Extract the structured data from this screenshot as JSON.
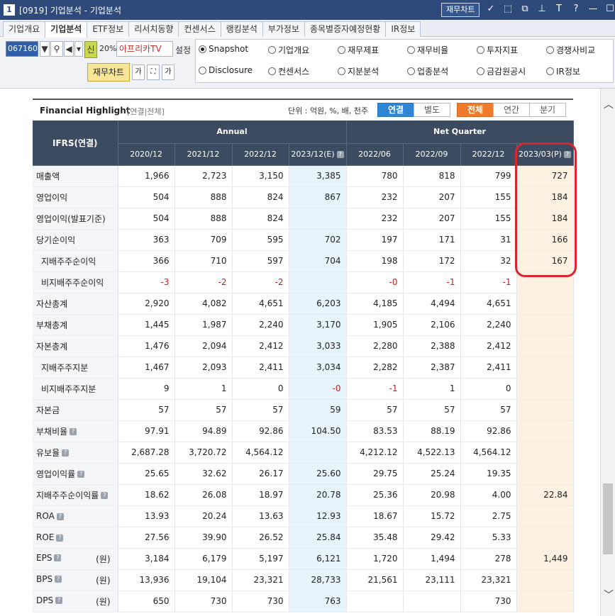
{
  "window": {
    "number": "1",
    "title": "[0919] 기업분석 - 기업분석",
    "chart_button": "재무차트",
    "icons": [
      "link-icon",
      "restore-icon",
      "copy-icon",
      "pin-icon",
      "font-icon",
      "help-icon",
      "minimize-icon",
      "maximize-icon",
      "close-icon"
    ],
    "icon_glyphs": [
      "✓",
      "⬚",
      "⧉",
      "⊥",
      "T",
      "?",
      "—",
      "☐",
      "✕"
    ]
  },
  "tabs": [
    "기업개요",
    "기업분석",
    "ETF정보",
    "리서치동향",
    "컨센서스",
    "랭킹분석",
    "부가정보",
    "종목별증자예정현황",
    "IR정보"
  ],
  "active_tab": "기업분석",
  "toolbar": {
    "stock_code": "067160",
    "shin_label": "신",
    "percent": "20%",
    "stock_name": "아프리카TV",
    "setting_label": "설정",
    "fin_chart_button": "재무차트"
  },
  "radios": [
    {
      "label": "Snapshot",
      "checked": true
    },
    {
      "label": "기업개요",
      "checked": false
    },
    {
      "label": "재무제표",
      "checked": false
    },
    {
      "label": "재무비율",
      "checked": false
    },
    {
      "label": "투자지표",
      "checked": false
    },
    {
      "label": "경쟁사비교",
      "checked": false
    },
    {
      "label": "Disclosure",
      "checked": false
    },
    {
      "label": "컨센서스",
      "checked": false
    },
    {
      "label": "지분분석",
      "checked": false
    },
    {
      "label": "업종분석",
      "checked": false
    },
    {
      "label": "금감원공시",
      "checked": false
    },
    {
      "label": "IR정보",
      "checked": false
    }
  ],
  "highlight": {
    "title": "Financial Highlight",
    "subtitle": "[연결|전체]",
    "unit": "단위 : 억원, %, 배, 천주",
    "consolidation_toggle": [
      "연결",
      "별도"
    ],
    "consolidation_selected": "연결",
    "period_toggle": [
      "전체",
      "연간",
      "분기"
    ],
    "period_selected": "전체"
  },
  "table": {
    "row_header": "IFRS(연결)",
    "group_annual": "Annual",
    "group_quarter": "Net Quarter",
    "columns": [
      "2020/12",
      "2021/12",
      "2022/12",
      "2023/12(E)",
      "2022/06",
      "2022/09",
      "2022/12",
      "2023/03(P)"
    ],
    "rows": [
      {
        "label": "매출액",
        "sub": false,
        "info": false,
        "unit": "",
        "values": [
          "1,966",
          "2,723",
          "3,150",
          "3,385",
          "780",
          "818",
          "799",
          "727"
        ]
      },
      {
        "label": "영업이익",
        "sub": false,
        "info": false,
        "unit": "",
        "values": [
          "504",
          "888",
          "824",
          "867",
          "232",
          "207",
          "155",
          "184"
        ]
      },
      {
        "label": "영업이익(발표기준)",
        "sub": false,
        "info": false,
        "unit": "",
        "values": [
          "504",
          "888",
          "824",
          "",
          "232",
          "207",
          "155",
          "184"
        ]
      },
      {
        "label": "당기순이익",
        "sub": false,
        "info": false,
        "unit": "",
        "values": [
          "363",
          "709",
          "595",
          "702",
          "197",
          "171",
          "31",
          "166"
        ]
      },
      {
        "label": "지배주주순이익",
        "sub": true,
        "info": false,
        "unit": "",
        "values": [
          "366",
          "710",
          "597",
          "704",
          "198",
          "172",
          "32",
          "167"
        ]
      },
      {
        "label": "비지배주주순이익",
        "sub": true,
        "info": false,
        "unit": "",
        "values": [
          "-3",
          "-2",
          "-2",
          "",
          "-0",
          "-1",
          "-1",
          ""
        ]
      },
      {
        "label": "자산총계",
        "sub": false,
        "info": false,
        "unit": "",
        "values": [
          "2,920",
          "4,082",
          "4,651",
          "6,203",
          "4,185",
          "4,494",
          "4,651",
          ""
        ]
      },
      {
        "label": "부채총계",
        "sub": false,
        "info": false,
        "unit": "",
        "values": [
          "1,445",
          "1,987",
          "2,240",
          "3,170",
          "1,905",
          "2,106",
          "2,240",
          ""
        ]
      },
      {
        "label": "자본총계",
        "sub": false,
        "info": false,
        "unit": "",
        "values": [
          "1,476",
          "2,094",
          "2,412",
          "3,033",
          "2,280",
          "2,388",
          "2,412",
          ""
        ]
      },
      {
        "label": "지배주주지분",
        "sub": true,
        "info": false,
        "unit": "",
        "values": [
          "1,467",
          "2,093",
          "2,411",
          "3,034",
          "2,282",
          "2,387",
          "2,411",
          ""
        ]
      },
      {
        "label": "비지배주주지분",
        "sub": true,
        "info": false,
        "unit": "",
        "values": [
          "9",
          "1",
          "0",
          "-0",
          "-1",
          "1",
          "0",
          ""
        ]
      },
      {
        "label": "자본금",
        "sub": false,
        "info": false,
        "unit": "",
        "values": [
          "57",
          "57",
          "57",
          "59",
          "57",
          "57",
          "57",
          ""
        ]
      },
      {
        "label": "부채비율",
        "sub": false,
        "info": true,
        "unit": "",
        "values": [
          "97.91",
          "94.89",
          "92.86",
          "104.50",
          "83.53",
          "88.19",
          "92.86",
          ""
        ]
      },
      {
        "label": "유보율",
        "sub": false,
        "info": true,
        "unit": "",
        "values": [
          "2,687.28",
          "3,720.72",
          "4,564.12",
          "",
          "4,212.12",
          "4,522.13",
          "4,564.12",
          ""
        ]
      },
      {
        "label": "영업이익률",
        "sub": false,
        "info": true,
        "unit": "",
        "values": [
          "25.65",
          "32.62",
          "26.17",
          "25.60",
          "29.75",
          "25.24",
          "19.35",
          ""
        ]
      },
      {
        "label": "지배주주순이익률",
        "sub": false,
        "info": true,
        "unit": "",
        "values": [
          "18.62",
          "26.08",
          "18.97",
          "20.78",
          "25.36",
          "20.98",
          "4.00",
          "22.84"
        ]
      },
      {
        "label": "ROA",
        "sub": false,
        "info": true,
        "unit": "",
        "values": [
          "13.93",
          "20.24",
          "13.63",
          "12.93",
          "18.67",
          "15.72",
          "2.75",
          ""
        ]
      },
      {
        "label": "ROE",
        "sub": false,
        "info": true,
        "unit": "",
        "values": [
          "27.56",
          "39.90",
          "26.52",
          "25.84",
          "35.48",
          "29.42",
          "5.33",
          ""
        ]
      },
      {
        "label": "EPS",
        "sub": false,
        "info": true,
        "unit": "(원)",
        "values": [
          "3,184",
          "6,179",
          "5,197",
          "6,121",
          "1,720",
          "1,494",
          "278",
          "1,449"
        ]
      },
      {
        "label": "BPS",
        "sub": false,
        "info": true,
        "unit": "(원)",
        "values": [
          "13,936",
          "19,104",
          "23,321",
          "28,733",
          "21,561",
          "23,111",
          "23,321",
          ""
        ]
      },
      {
        "label": "DPS",
        "sub": false,
        "info": true,
        "unit": "(원)",
        "values": [
          "650",
          "730",
          "730",
          "763",
          "",
          "",
          "730",
          ""
        ]
      }
    ]
  },
  "colors": {
    "header_bg": "#3c4b5f",
    "estimate_bg": "#e7f4fb",
    "provisional_bg": "#fdf1e2",
    "negative": "#c02020",
    "annotation_box": "#d9262e",
    "toggle_blue": "#2f86d6",
    "toggle_orange": "#ee7b2c"
  }
}
